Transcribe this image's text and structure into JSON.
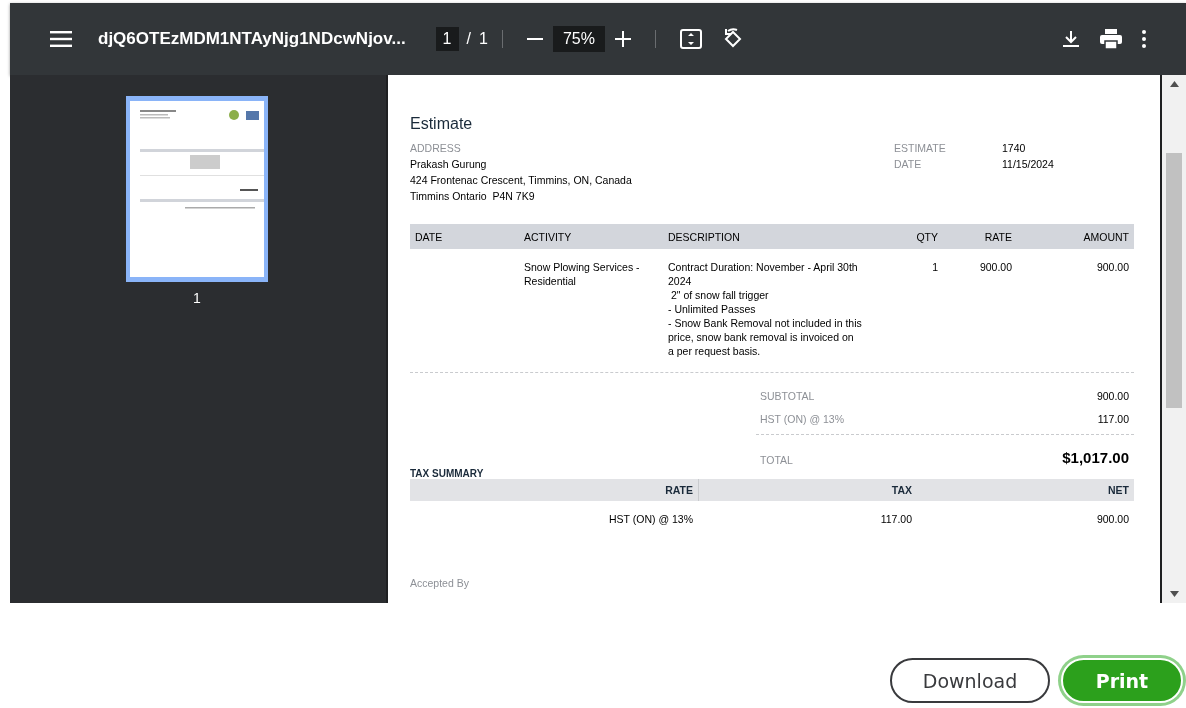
{
  "toolbar": {
    "title": "djQ6OTEzMDM1NTAyNjg1NDcwNjov...",
    "page": "1",
    "page_separator": "/",
    "page_total": "1",
    "zoom": "75%"
  },
  "sidebar": {
    "thumbnails": [
      {
        "label": "1",
        "selected": true
      }
    ]
  },
  "document": {
    "title": "Estimate",
    "address_label": "ADDRESS",
    "address_lines": [
      "Prakash Gurung",
      "424 Frontenac Crescent, Timmins, ON, Canada",
      "Timmins Ontario  P4N 7K9"
    ],
    "meta": [
      {
        "label": "ESTIMATE",
        "value": "1740"
      },
      {
        "label": "DATE",
        "value": "11/15/2024"
      }
    ],
    "table": {
      "columns": [
        "DATE",
        "ACTIVITY",
        "DESCRIPTION",
        "QTY",
        "RATE",
        "AMOUNT"
      ],
      "rows": [
        {
          "date": "",
          "activity": "Snow Plowing Services - Residential",
          "description": "Contract Duration: November - April 30th 2024\n 2\" of snow fall trigger\n- Unlimited Passes\n- Snow Bank Removal not included in this price, snow bank removal is invoiced on a per request basis.",
          "qty": "1",
          "rate": "900.00",
          "amount": "900.00"
        }
      ]
    },
    "totals": [
      {
        "label": "SUBTOTAL",
        "value": "900.00"
      },
      {
        "label": "HST (ON) @ 13%",
        "value": "117.00"
      }
    ],
    "total": {
      "label": "TOTAL",
      "value": "$1,017.00"
    },
    "tax_summary": {
      "title": "TAX SUMMARY",
      "columns": [
        "RATE",
        "TAX",
        "NET"
      ],
      "rows": [
        [
          "HST (ON) @ 13%",
          "117.00",
          "900.00"
        ]
      ]
    },
    "accepted_by": "Accepted By"
  },
  "buttons": [
    {
      "label": "Download",
      "kind": "secondary"
    },
    {
      "label": "Print",
      "kind": "primary"
    }
  ]
}
